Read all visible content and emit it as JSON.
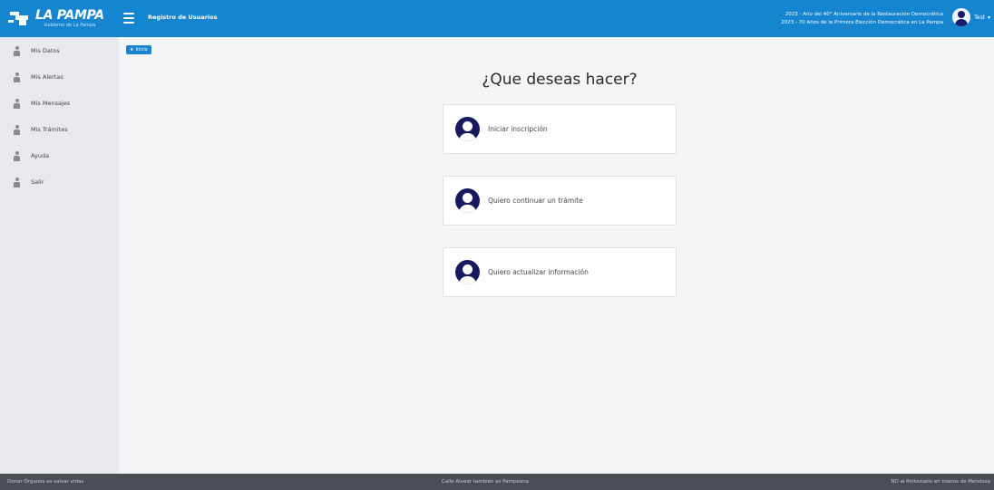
{
  "header": {
    "logo_title": "LA PAMPA",
    "logo_subtitle": "Gobierno de La Pampa",
    "menu_icon": "hamburger-menu-icon",
    "app_title": "Registro de Usuarios",
    "notice_1": "2023 - Año del 40° Aniversario de la Restauración Democrática",
    "notice_2": "2023 - 70 Años de la Primera Elección Democrática en La Pampa",
    "user_name": "Test",
    "user_caret": "▾"
  },
  "sidebar": {
    "items": [
      {
        "label": "Mis Datos",
        "icon": "user-icon"
      },
      {
        "label": "Mis Alertas",
        "icon": "user-icon"
      },
      {
        "label": "Mis Mensajes",
        "icon": "user-icon"
      },
      {
        "label": "Mis Trámites",
        "icon": "user-icon"
      },
      {
        "label": "Ayuda",
        "icon": "user-icon"
      },
      {
        "label": "Salir",
        "icon": "user-icon"
      }
    ]
  },
  "breadcrumb": {
    "home_icon": "★",
    "label": "Inicio"
  },
  "main": {
    "title": "¿Que deseas hacer?",
    "options": [
      {
        "label": "Iniciar inscripción",
        "icon": "user-circle-icon"
      },
      {
        "label": "Quiero continuar un trámite",
        "icon": "user-circle-icon"
      },
      {
        "label": "Quiero actualizar información",
        "icon": "user-circle-icon"
      }
    ]
  },
  "footer": {
    "left": "Donar Órganos es salvar vidas",
    "center": "Calle Alvear también es Pampeana",
    "right": "NO al Portezuelo en manos de Mendoza"
  },
  "colors": {
    "header_bg": "#1585cf",
    "sidebar_bg": "#e7e9ec",
    "page_bg": "#f4f5f7",
    "card_icon": "#181a60",
    "footer_bg": "#4b4e54"
  }
}
